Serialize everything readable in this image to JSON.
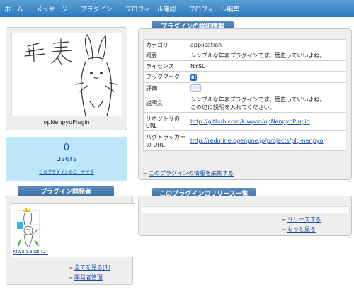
{
  "nav": {
    "items": [
      "ホーム",
      "メッセージ",
      "プラグイン",
      "プロフィール確認",
      "プロフィール編集"
    ]
  },
  "photo": {
    "caption": "opNenpyoPlugin"
  },
  "users": {
    "count": "0",
    "label": "users",
    "link": "このプラグインのユーザです"
  },
  "developers": {
    "title": "プラグイン開発者",
    "members": [
      {
        "name": "Kiwa Sakai (2)"
      }
    ],
    "see_all": "全てを見る(1)",
    "manage": "開発者管理"
  },
  "details": {
    "title": "プラグインの詳細情報",
    "rows": [
      {
        "key": "カテゴリ",
        "value": "application"
      },
      {
        "key": "概要",
        "value": "シンプルな年表プラグインです。歴史っていいよね。"
      },
      {
        "key": "ライセンス",
        "value": "NYSL"
      },
      {
        "key": "ブックマーク",
        "value": "B!"
      },
      {
        "key": "評価",
        "value": ""
      },
      {
        "key": "説明文",
        "value": "シンプルな年表プラグインです。歴史っていいよね。",
        "value2": "この辺に説明を入れてください。"
      },
      {
        "key": "リポジトリの",
        "key2": "URL",
        "value": "http://github.com/kiwpon/opNenpyoPlugin"
      },
      {
        "key": "バグトラッカー",
        "key2": "の URL",
        "value": "http://redmine.openpne.jp/projects/plg-nenpyo"
      }
    ],
    "edit_link": "このプラグインの情報を編集する"
  },
  "releases": {
    "title": "このプラグインのリリース一覧",
    "release_link": "リリースする",
    "more_link": "もっと見る"
  },
  "colors": {
    "nav": "#2d79bd",
    "tab": "#36689d",
    "users_bg": "#bfe7fb",
    "link": "#1d4fa6"
  }
}
